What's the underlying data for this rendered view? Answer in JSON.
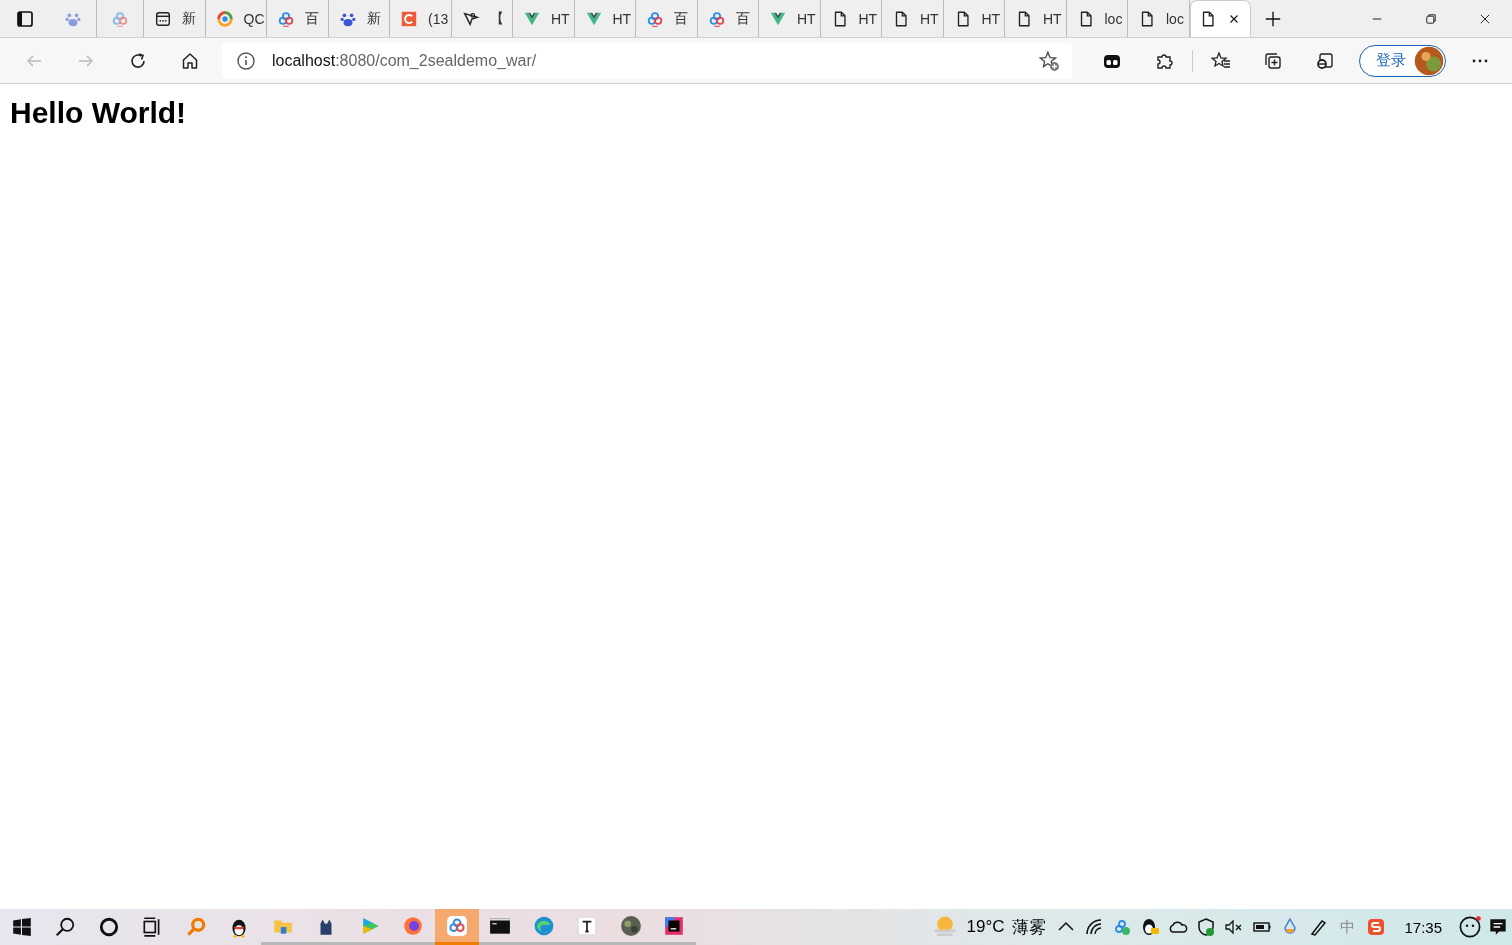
{
  "tabs": [
    {
      "kind": "paw",
      "selected": false
    },
    {
      "kind": "cloud",
      "selected": false
    },
    {
      "kind": "card",
      "label": "新",
      "selected": false
    },
    {
      "kind": "ring",
      "label": "QC",
      "selected": false
    },
    {
      "kind": "cloud",
      "label": "百",
      "selected": false
    },
    {
      "kind": "paw",
      "label": "新",
      "selected": false
    },
    {
      "kind": "cletter",
      "label": "(13",
      "selected": false
    },
    {
      "kind": "pen",
      "label": "【",
      "selected": false
    },
    {
      "kind": "vee",
      "label": "HT",
      "selected": false
    },
    {
      "kind": "vee",
      "label": "HT",
      "selected": false
    },
    {
      "kind": "cloud",
      "label": "百",
      "selected": false
    },
    {
      "kind": "cloud",
      "label": "百",
      "selected": false
    },
    {
      "kind": "vee",
      "label": "HT",
      "selected": false
    },
    {
      "kind": "doc",
      "label": "HT",
      "selected": false
    },
    {
      "kind": "doc",
      "label": "HT",
      "selected": false
    },
    {
      "kind": "doc",
      "label": "HT",
      "selected": false
    },
    {
      "kind": "doc",
      "label": "HT",
      "selected": false
    },
    {
      "kind": "doc",
      "label": "loc",
      "selected": false
    },
    {
      "kind": "doc",
      "label": "loc",
      "selected": false
    },
    {
      "kind": "doc",
      "selected": true
    }
  ],
  "address": {
    "host": "localhost",
    "rest": ":8080/com_2sealdemo_war/"
  },
  "sign_in": "登录",
  "page": {
    "heading": "Hello World!"
  },
  "taskbar": {
    "apps": [
      {
        "kind": "start",
        "selected": false,
        "running": false
      },
      {
        "kind": "search",
        "selected": false,
        "running": false
      },
      {
        "kind": "cortana",
        "selected": false,
        "running": false
      },
      {
        "kind": "taskview",
        "selected": false,
        "running": false
      },
      {
        "kind": "magnifier",
        "selected": false,
        "running": false
      },
      {
        "kind": "penguin",
        "selected": false,
        "running": false
      },
      {
        "kind": "folder",
        "selected": false,
        "running": true
      },
      {
        "kind": "cat",
        "selected": false,
        "running": true
      },
      {
        "kind": "play",
        "selected": false,
        "running": true
      },
      {
        "kind": "firefox",
        "selected": false,
        "running": true
      },
      {
        "kind": "cloud",
        "selected": true,
        "running": true
      },
      {
        "kind": "terminal",
        "selected": false,
        "running": true
      },
      {
        "kind": "edge",
        "selected": false,
        "running": true
      },
      {
        "kind": "typora",
        "selected": false,
        "running": true
      },
      {
        "kind": "globe",
        "selected": false,
        "running": true
      },
      {
        "kind": "ide",
        "selected": false,
        "running": true
      }
    ],
    "weather": {
      "temp": "19°C",
      "condition": "薄雾"
    },
    "tray": [
      {
        "kind": "chevron"
      },
      {
        "kind": "wifi"
      },
      {
        "kind": "cloud"
      },
      {
        "kind": "penguin"
      },
      {
        "kind": "onedrive"
      },
      {
        "kind": "shield"
      },
      {
        "kind": "mute"
      },
      {
        "kind": "battery"
      },
      {
        "kind": "drop"
      },
      {
        "kind": "pen"
      }
    ],
    "ime": "中",
    "time": "17:35"
  }
}
